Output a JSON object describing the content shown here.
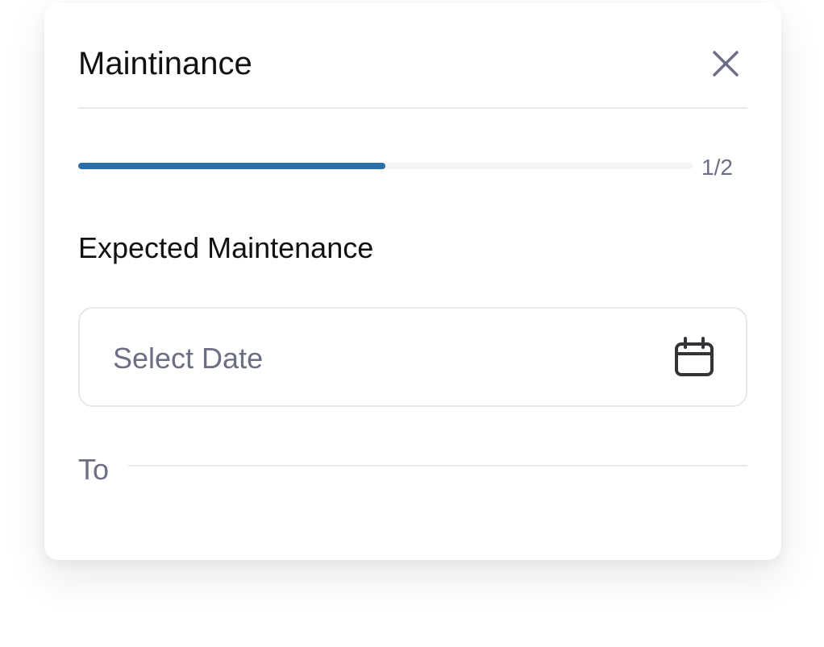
{
  "dialog": {
    "title": "Maintinance",
    "close_icon": "close-icon",
    "progress": {
      "label": "1/2",
      "fraction": 0.5,
      "color": "#2e6ea7"
    },
    "section_heading": "Expected Maintenance",
    "date_field": {
      "placeholder": "Select Date",
      "icon": "calendar-icon"
    },
    "to_label": "To"
  }
}
